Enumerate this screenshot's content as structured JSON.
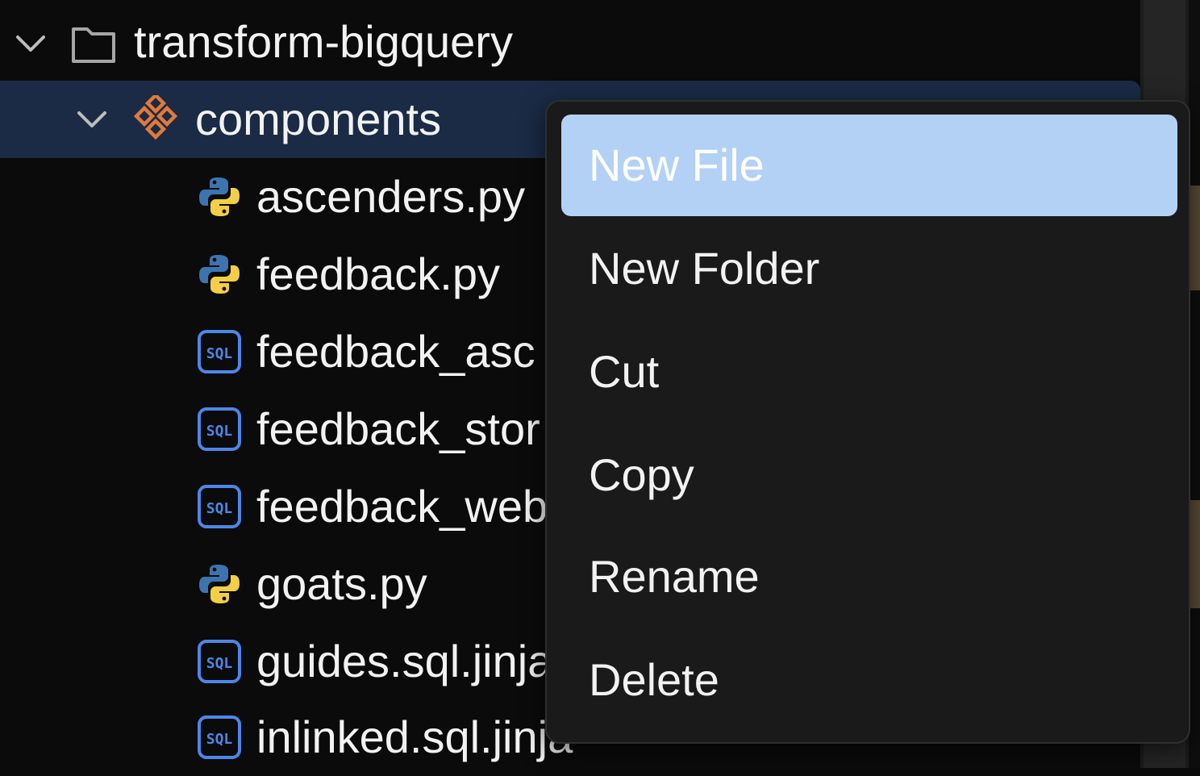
{
  "explorer": {
    "root": {
      "label": "transform-bigquery",
      "icon": "folder-icon",
      "expanded": true
    },
    "folder": {
      "label": "components",
      "icon": "components-icon",
      "expanded": true,
      "selected": true
    },
    "files": [
      {
        "label": "ascenders.py",
        "icon": "python-icon"
      },
      {
        "label": "feedback.py",
        "icon": "python-icon"
      },
      {
        "label": "feedback_asc",
        "icon": "sql-icon"
      },
      {
        "label": "feedback_stor",
        "icon": "sql-icon"
      },
      {
        "label": "feedback_web",
        "icon": "sql-icon"
      },
      {
        "label": "goats.py",
        "icon": "python-icon"
      },
      {
        "label": "guides.sql.jinja",
        "icon": "sql-icon"
      },
      {
        "label": "inlinked.sql.jinja",
        "icon": "sql-icon"
      }
    ],
    "sql_badge": "SQL"
  },
  "context_menu": {
    "items": [
      {
        "label": "New File",
        "highlighted": true
      },
      {
        "label": "New Folder",
        "highlighted": false
      },
      {
        "label": "Cut",
        "highlighted": false
      },
      {
        "label": "Copy",
        "highlighted": false
      },
      {
        "label": "Rename",
        "highlighted": false
      },
      {
        "label": "Delete",
        "highlighted": false
      }
    ]
  },
  "colors": {
    "background": "#0b0b0b",
    "selected_row": "#1b2b45",
    "menu_background": "#1a1a1a",
    "menu_highlight": "#b3d1f5",
    "sql_icon": "#4d86e8",
    "components_icon": "#e07a3c",
    "python_blue": "#3d74b0",
    "python_yellow": "#f2cf46"
  }
}
